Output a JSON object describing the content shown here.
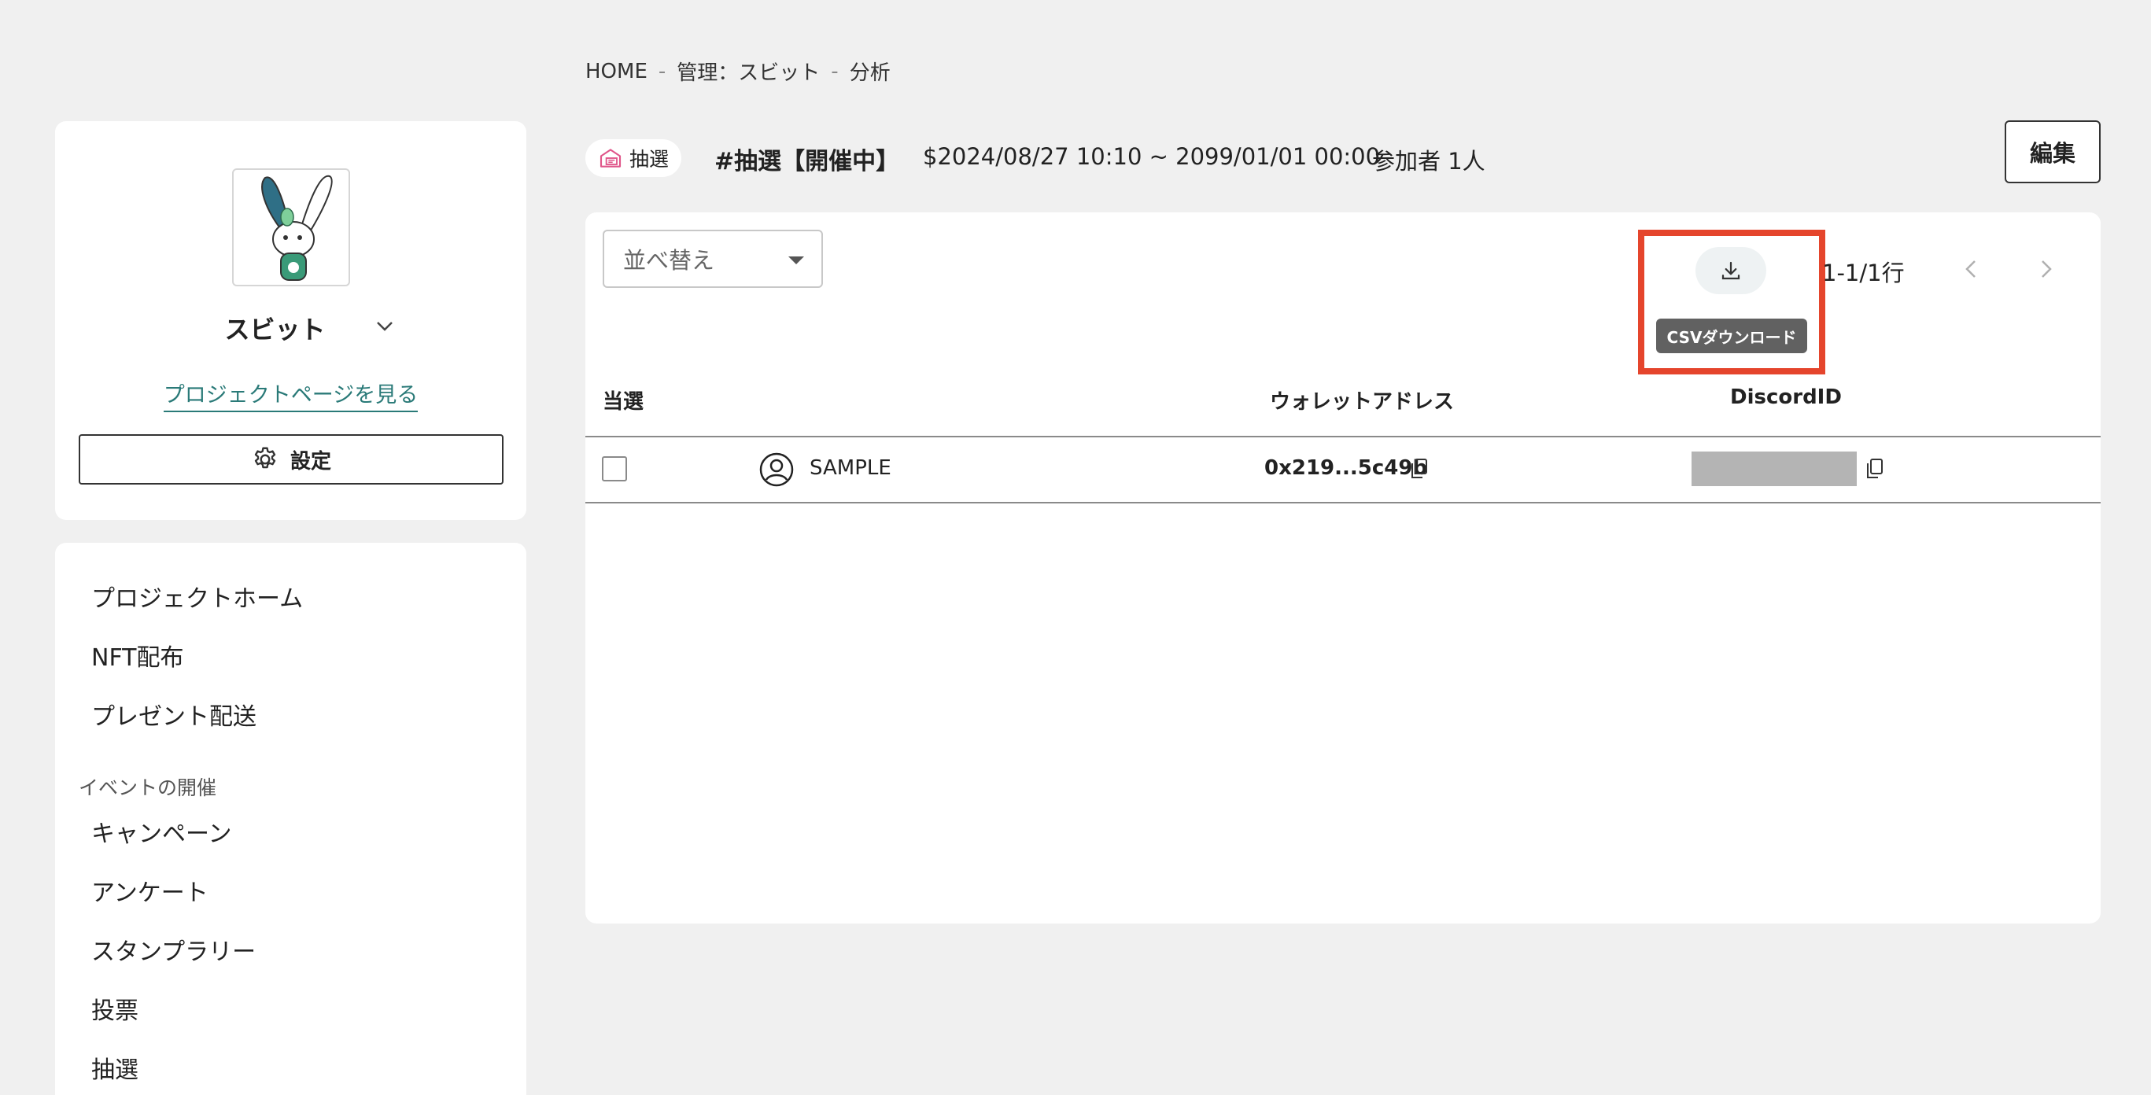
{
  "breadcrumb": {
    "home": "HOME",
    "manage": "管理：スビット",
    "current": "分析",
    "separator": "-"
  },
  "sidebar": {
    "project_name": "スビット",
    "project_page_link": "プロジェクトページを見る",
    "settings_label": "設定",
    "menu_items": [
      "プロジェクトホーム",
      "NFT配布",
      "プレゼント配送"
    ],
    "events_heading": "イベントの開催",
    "event_items": [
      "キャンペーン",
      "アンケート",
      "スタンプラリー",
      "投票",
      "抽選"
    ]
  },
  "header": {
    "badge_label": "抽選",
    "event_title": "#抽選【開催中】",
    "period": "$2024/08/27 10:10 ~ 2099/01/01 00:00",
    "participants": "参加者 1人",
    "edit_label": "編集"
  },
  "toolbar": {
    "sort_label": "並べ替え",
    "download_tooltip": "CSVダウンロード",
    "page_range": "1-1/1行"
  },
  "table": {
    "columns": [
      "当選",
      "ウォレットアドレス",
      "DiscordID"
    ],
    "rows": [
      {
        "user": "SAMPLE",
        "wallet": "0x219...5c49b",
        "discord": ""
      }
    ]
  },
  "colors": {
    "accent_link": "#2a7a78",
    "highlight": "#e5452c",
    "tooltip_bg": "#616161",
    "badge_icon": "#e0568a"
  },
  "icons": {
    "badge": "gift-ticket-icon",
    "settings": "gear-icon",
    "download": "download-icon",
    "user": "user-circle-icon",
    "copy": "copy-icon"
  }
}
